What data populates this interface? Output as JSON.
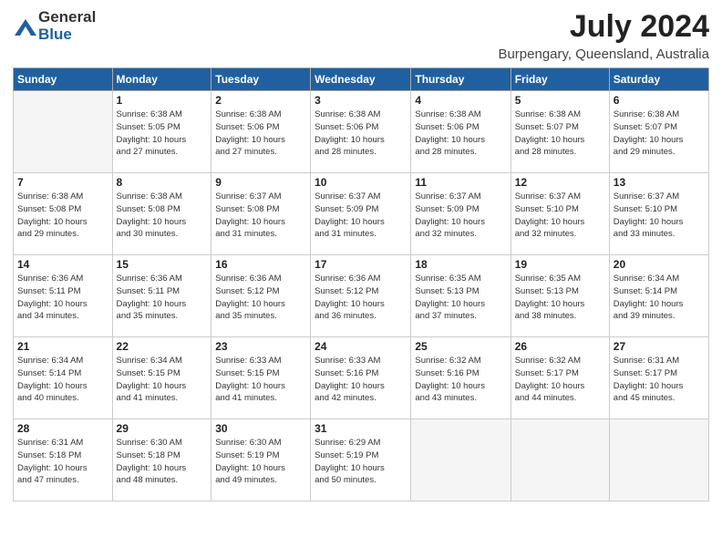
{
  "header": {
    "logo_general": "General",
    "logo_blue": "Blue",
    "main_title": "July 2024",
    "subtitle": "Burpengary, Queensland, Australia"
  },
  "weekdays": [
    "Sunday",
    "Monday",
    "Tuesday",
    "Wednesday",
    "Thursday",
    "Friday",
    "Saturday"
  ],
  "weeks": [
    [
      {
        "day": "",
        "empty": true
      },
      {
        "day": "1",
        "sunrise": "6:38 AM",
        "sunset": "5:05 PM",
        "daylight": "10 hours and 27 minutes."
      },
      {
        "day": "2",
        "sunrise": "6:38 AM",
        "sunset": "5:06 PM",
        "daylight": "10 hours and 27 minutes."
      },
      {
        "day": "3",
        "sunrise": "6:38 AM",
        "sunset": "5:06 PM",
        "daylight": "10 hours and 28 minutes."
      },
      {
        "day": "4",
        "sunrise": "6:38 AM",
        "sunset": "5:06 PM",
        "daylight": "10 hours and 28 minutes."
      },
      {
        "day": "5",
        "sunrise": "6:38 AM",
        "sunset": "5:07 PM",
        "daylight": "10 hours and 28 minutes."
      },
      {
        "day": "6",
        "sunrise": "6:38 AM",
        "sunset": "5:07 PM",
        "daylight": "10 hours and 29 minutes."
      }
    ],
    [
      {
        "day": "7",
        "sunrise": "6:38 AM",
        "sunset": "5:08 PM",
        "daylight": "10 hours and 29 minutes."
      },
      {
        "day": "8",
        "sunrise": "6:38 AM",
        "sunset": "5:08 PM",
        "daylight": "10 hours and 30 minutes."
      },
      {
        "day": "9",
        "sunrise": "6:37 AM",
        "sunset": "5:08 PM",
        "daylight": "10 hours and 31 minutes."
      },
      {
        "day": "10",
        "sunrise": "6:37 AM",
        "sunset": "5:09 PM",
        "daylight": "10 hours and 31 minutes."
      },
      {
        "day": "11",
        "sunrise": "6:37 AM",
        "sunset": "5:09 PM",
        "daylight": "10 hours and 32 minutes."
      },
      {
        "day": "12",
        "sunrise": "6:37 AM",
        "sunset": "5:10 PM",
        "daylight": "10 hours and 32 minutes."
      },
      {
        "day": "13",
        "sunrise": "6:37 AM",
        "sunset": "5:10 PM",
        "daylight": "10 hours and 33 minutes."
      }
    ],
    [
      {
        "day": "14",
        "sunrise": "6:36 AM",
        "sunset": "5:11 PM",
        "daylight": "10 hours and 34 minutes."
      },
      {
        "day": "15",
        "sunrise": "6:36 AM",
        "sunset": "5:11 PM",
        "daylight": "10 hours and 35 minutes."
      },
      {
        "day": "16",
        "sunrise": "6:36 AM",
        "sunset": "5:12 PM",
        "daylight": "10 hours and 35 minutes."
      },
      {
        "day": "17",
        "sunrise": "6:36 AM",
        "sunset": "5:12 PM",
        "daylight": "10 hours and 36 minutes."
      },
      {
        "day": "18",
        "sunrise": "6:35 AM",
        "sunset": "5:13 PM",
        "daylight": "10 hours and 37 minutes."
      },
      {
        "day": "19",
        "sunrise": "6:35 AM",
        "sunset": "5:13 PM",
        "daylight": "10 hours and 38 minutes."
      },
      {
        "day": "20",
        "sunrise": "6:34 AM",
        "sunset": "5:14 PM",
        "daylight": "10 hours and 39 minutes."
      }
    ],
    [
      {
        "day": "21",
        "sunrise": "6:34 AM",
        "sunset": "5:14 PM",
        "daylight": "10 hours and 40 minutes."
      },
      {
        "day": "22",
        "sunrise": "6:34 AM",
        "sunset": "5:15 PM",
        "daylight": "10 hours and 41 minutes."
      },
      {
        "day": "23",
        "sunrise": "6:33 AM",
        "sunset": "5:15 PM",
        "daylight": "10 hours and 41 minutes."
      },
      {
        "day": "24",
        "sunrise": "6:33 AM",
        "sunset": "5:16 PM",
        "daylight": "10 hours and 42 minutes."
      },
      {
        "day": "25",
        "sunrise": "6:32 AM",
        "sunset": "5:16 PM",
        "daylight": "10 hours and 43 minutes."
      },
      {
        "day": "26",
        "sunrise": "6:32 AM",
        "sunset": "5:17 PM",
        "daylight": "10 hours and 44 minutes."
      },
      {
        "day": "27",
        "sunrise": "6:31 AM",
        "sunset": "5:17 PM",
        "daylight": "10 hours and 45 minutes."
      }
    ],
    [
      {
        "day": "28",
        "sunrise": "6:31 AM",
        "sunset": "5:18 PM",
        "daylight": "10 hours and 47 minutes."
      },
      {
        "day": "29",
        "sunrise": "6:30 AM",
        "sunset": "5:18 PM",
        "daylight": "10 hours and 48 minutes."
      },
      {
        "day": "30",
        "sunrise": "6:30 AM",
        "sunset": "5:19 PM",
        "daylight": "10 hours and 49 minutes."
      },
      {
        "day": "31",
        "sunrise": "6:29 AM",
        "sunset": "5:19 PM",
        "daylight": "10 hours and 50 minutes."
      },
      {
        "day": "",
        "empty": true
      },
      {
        "day": "",
        "empty": true
      },
      {
        "day": "",
        "empty": true
      }
    ]
  ]
}
